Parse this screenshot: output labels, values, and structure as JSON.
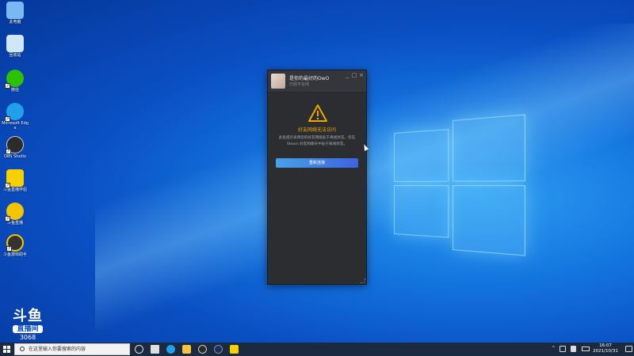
{
  "desktop": {
    "icons": [
      {
        "label": "此电脑",
        "icon": "computer-icon",
        "color": "#79b8f2"
      },
      {
        "label": "回收站",
        "icon": "recycle-bin-icon",
        "color": "#cfe6f7"
      },
      {
        "label": "微信",
        "icon": "wechat-icon",
        "color": "#2dc100"
      },
      {
        "label": "Microsoft Edge",
        "icon": "edge-icon",
        "color": "#1fa0e8"
      },
      {
        "label": "OBS Studio",
        "icon": "obs-icon",
        "color": "#2b2b2b"
      },
      {
        "label": "斗鱼直播伴侣",
        "icon": "douyu-companion-icon",
        "color": "#f8d000"
      },
      {
        "label": "斗鱼直播",
        "icon": "douyu-live-icon",
        "color": "#f5c400"
      },
      {
        "label": "斗鱼游戏助手",
        "icon": "game-assistant-icon",
        "color": "#333333"
      }
    ]
  },
  "watermark": {
    "brand": "斗鱼",
    "tag": "直播间",
    "room": "3068"
  },
  "friend_window": {
    "user_name": "是你的最好的OwO",
    "user_status": "已经不在线",
    "error_title": "好友网络无法访问",
    "error_desc": "此处提示表明您的好友网络处于离线状态。您在 Steam 好友和聊天中处于离线状态。",
    "reconnect_label": "重新连接",
    "minimize": "_",
    "maximize": "□",
    "close": "×",
    "accent": "#f0a500"
  },
  "taskbar": {
    "search_placeholder": "在这里输入你要搜索的内容",
    "apps": [
      {
        "icon": "task-view-icon",
        "color": "#dddddd"
      },
      {
        "icon": "edge-taskbar-icon",
        "color": "#1fa0e8"
      },
      {
        "icon": "file-explorer-icon",
        "color": "#f6c343"
      },
      {
        "icon": "obs-taskbar-icon",
        "color": "#2b2b2b"
      },
      {
        "icon": "steam-taskbar-icon",
        "color": "#16315a"
      },
      {
        "icon": "douyu-taskbar-icon",
        "color": "#f8d000"
      }
    ],
    "time": "16:07",
    "date": "2021/10/31"
  }
}
